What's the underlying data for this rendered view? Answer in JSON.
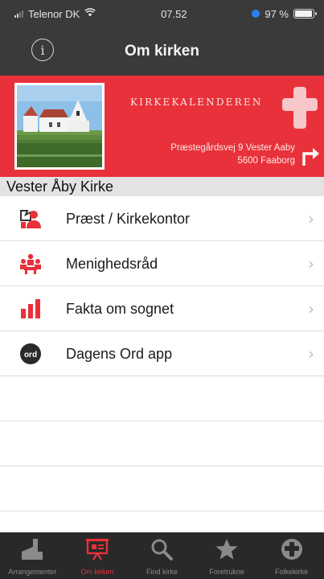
{
  "status_bar": {
    "carrier": "Telenor DK",
    "time": "07.52",
    "battery": "97 %",
    "battery_level": 0.97
  },
  "nav": {
    "title": "Om kirken",
    "info_icon": "info-icon"
  },
  "banner": {
    "brand": "KIRKEKALENDEREN",
    "address_line1": "Præstegårdsvej 9 Vester Aaby",
    "address_line2": "5600 Faaborg",
    "background": "#e8313a"
  },
  "section_title": "Vester Åby Kirke",
  "menu": [
    {
      "label": "Præst / Kirkekontor",
      "icon": "people-icon"
    },
    {
      "label": "Menighedsråd",
      "icon": "council-icon"
    },
    {
      "label": "Fakta om sognet",
      "icon": "bar-chart-icon"
    },
    {
      "label": "Dagens Ord app",
      "icon": "ord-icon",
      "icon_text": "ord"
    }
  ],
  "tabs": [
    {
      "label": "Arrangementer",
      "icon": "church-icon",
      "active": false
    },
    {
      "label": "Om kirken",
      "icon": "presentation-icon",
      "active": true
    },
    {
      "label": "Find kirke",
      "icon": "search-icon",
      "active": false
    },
    {
      "label": "Foretrukne",
      "icon": "star-icon",
      "active": false
    },
    {
      "label": "Folkekirke",
      "icon": "cross-circle-icon",
      "active": false
    }
  ],
  "colors": {
    "accent": "#e8313a",
    "navbar": "#3a3a3a",
    "tabbar": "#292929"
  }
}
